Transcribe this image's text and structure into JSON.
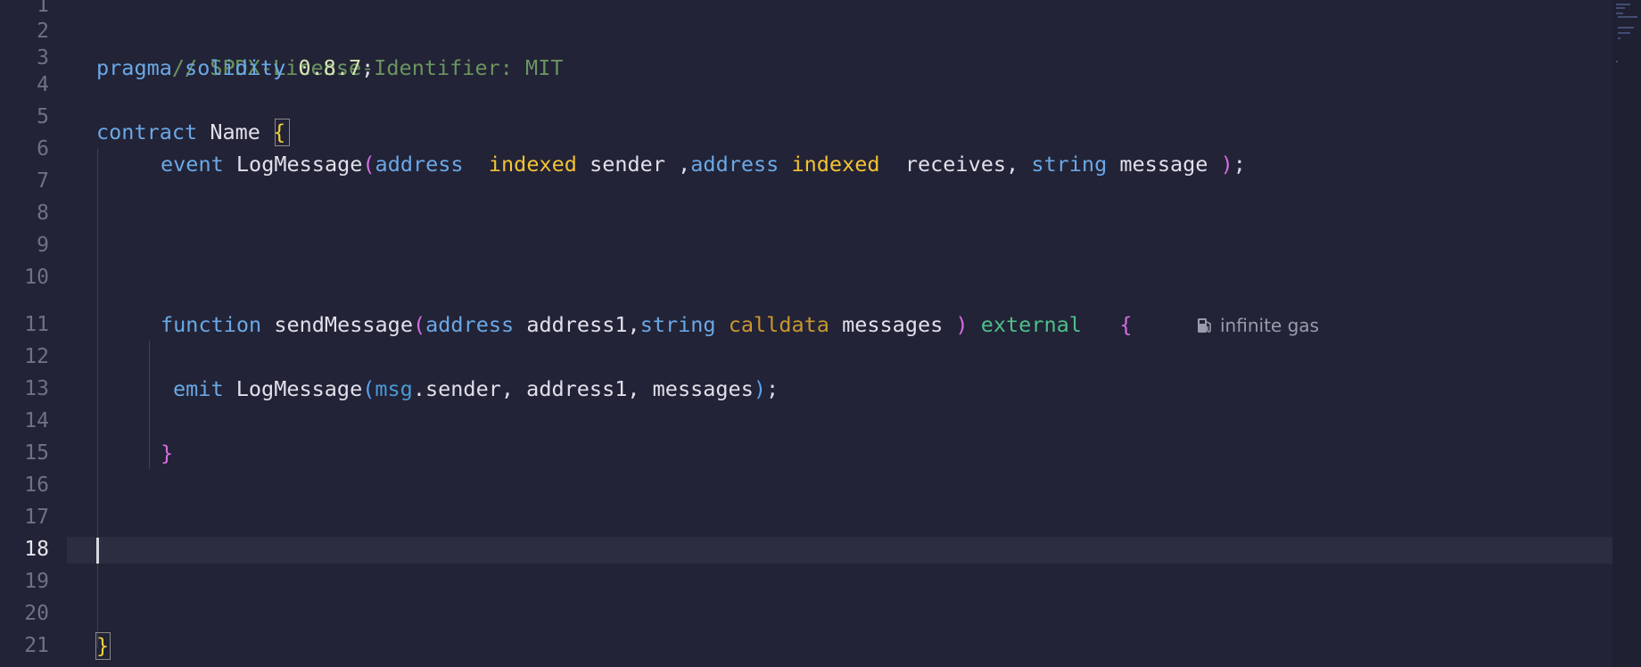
{
  "editor": {
    "gutter": {
      "line_numbers": [
        "1",
        "2",
        "3",
        "4",
        "5",
        "6",
        "7",
        "8",
        "9",
        "10",
        "11",
        "12",
        "13",
        "14",
        "15",
        "16",
        "17",
        "18",
        "19",
        "20",
        "21"
      ],
      "active_line": "18"
    },
    "lines": {
      "l2": {
        "comment": "// SPDX-License-Identifier: MIT"
      },
      "l3": {
        "kw": "pragma",
        "kw2": "solidity",
        "version": "0.8.7",
        "semi": ";"
      },
      "l5": {
        "kw": "contract",
        "name": "Name",
        "brace": "{"
      },
      "l6": {
        "kw": "event",
        "name": "LogMessage",
        "open": "(",
        "t1": "address",
        "idx1": "indexed",
        "a1": "sender ,",
        "t2": "address",
        "idx2": "indexed",
        "a2": "receives,",
        "t3": "string",
        "a3": "message",
        "close": ")",
        "semi": ";"
      },
      "l11": {
        "kw": "function",
        "name": "sendMessage",
        "open": "(",
        "t1": "address",
        "a1": "address1,",
        "t2": "string",
        "loc": "calldata",
        "a2": "messages",
        "close": ")",
        "vis": "external",
        "brace": "{"
      },
      "l13": {
        "kw": "emit",
        "name": "LogMessage",
        "open": "(",
        "msg": "msg",
        "rest": ".sender, address1, messages",
        "close": ")",
        "semi": ";"
      },
      "l15": {
        "brace": "}"
      },
      "l21": {
        "brace": "}"
      }
    },
    "codelens": {
      "gas_text": "infinite gas",
      "gas_icon": "fuel-pump-icon"
    }
  }
}
